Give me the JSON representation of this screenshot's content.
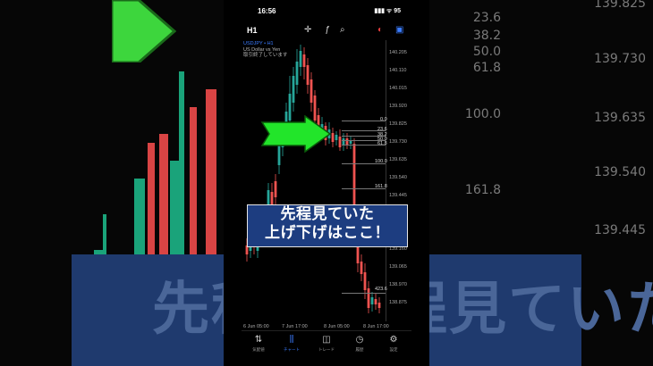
{
  "status": {
    "time": "16:56",
    "icons": "▮▮▮ ᯤ 95"
  },
  "topbar": {
    "timeframe": "H1",
    "crosshair_icon": "crosshair-icon",
    "indicator_icon": "function-icon",
    "objects_icon": "objects-icon"
  },
  "chart": {
    "symbol": "USDJPY • H1",
    "description": "US Dollar vs Yen",
    "note": "取引終了しています",
    "price_labels": [
      "140.205",
      "140.110",
      "140.015",
      "139.920",
      "139.825",
      "139.730",
      "139.635",
      "139.540",
      "139.445",
      "139.350",
      "139.255",
      "139.160",
      "139.065",
      "138.970",
      "138.875"
    ],
    "fib_levels": [
      "0.0",
      "23.6",
      "38.2",
      "50.0",
      "61.8",
      "100.0",
      "161.8",
      "423.6"
    ],
    "dates": [
      "6 Jun 05:00",
      "7 Jun 17:00",
      "8 Jun 05:00",
      "8 Jun 17:00"
    ],
    "up_color": "#26a69a",
    "down_color": "#ef5350"
  },
  "overlay": {
    "line1": "先程見ていた",
    "line2": "上げ下げはここ！"
  },
  "nav": {
    "quotes": "気配値",
    "chart": "チャート",
    "trade": "トレード",
    "history": "履歴",
    "settings": "設定"
  },
  "background": {
    "banner_text": "先程見ていた 上げ下げはここ！",
    "fib_rows": [
      {
        "level": "23.6",
        "price": "139.825"
      },
      {
        "level": "38.2",
        "price": ""
      },
      {
        "level": "50.0",
        "price": "139.730"
      },
      {
        "level": "61.8",
        "price": ""
      },
      {
        "level": "100.0",
        "price": "139.635"
      },
      {
        "level": "",
        "price": "139.540"
      },
      {
        "level": "161.8",
        "price": ""
      },
      {
        "level": "",
        "price": "139.445"
      }
    ]
  }
}
